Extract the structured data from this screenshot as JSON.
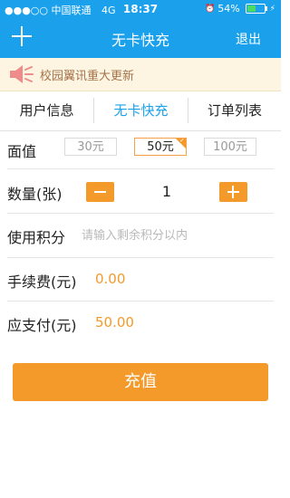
{
  "status_bar": {
    "signal": "●●●○○",
    "carrier": "中国联通",
    "network": "4G",
    "time": "18:37",
    "battery_percent": "54%",
    "battery_level": 0.54
  },
  "nav": {
    "title": "无卡快充",
    "exit_label": "退出"
  },
  "notice": {
    "text": "校园翼讯重大更新"
  },
  "tabs": [
    {
      "label": "用户信息",
      "active": false
    },
    {
      "label": "无卡快充",
      "active": true
    },
    {
      "label": "订单列表",
      "active": false
    }
  ],
  "form": {
    "face_value_label": "面值",
    "denominations": [
      {
        "label": "30元",
        "selected": false
      },
      {
        "label": "50元",
        "selected": true
      },
      {
        "label": "100元",
        "selected": false
      }
    ],
    "quantity_label": "数量(张)",
    "quantity": "1",
    "points_label": "使用积分",
    "points_placeholder": "请输入剩余积分以内",
    "fee_label": "手续费(元)",
    "fee_value": "0.00",
    "payable_label": "应支付(元)",
    "payable_value": "50.00"
  },
  "submit_label": "充值",
  "colors": {
    "primary": "#1ba1ec",
    "accent": "#f39a2b",
    "notice_bg": "#fdf5e2",
    "notice_text": "#a5734a"
  },
  "icons": {
    "add": "plus-icon",
    "notice": "speaker-icon",
    "minus": "minus-icon",
    "plus": "plus-icon"
  }
}
